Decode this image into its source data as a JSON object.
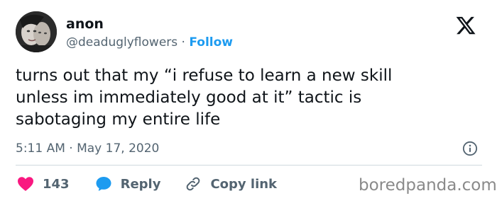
{
  "author": {
    "name": "anon",
    "handle": "@deaduglyflowers",
    "separator": "·",
    "follow_label": "Follow"
  },
  "tweet": {
    "text_lines": [
      "turns out that my “i refuse to learn a new skill",
      "unless im immediately good at it” tactic is",
      "sabotaging my entire life"
    ],
    "timestamp": "5:11 AM · May 17, 2020"
  },
  "actions": {
    "likes": "143",
    "reply_label": "Reply",
    "copy_link_label": "Copy link"
  },
  "icons": {
    "platform": "x-logo-icon",
    "info": "info-icon",
    "like": "heart-icon",
    "reply": "speech-bubble-icon",
    "link": "link-icon"
  },
  "colors": {
    "like": "#f91880",
    "reply": "#1d9bf0",
    "follow": "#1d9bf0",
    "secondary_text": "#536471"
  },
  "watermark": "boredpanda.com"
}
